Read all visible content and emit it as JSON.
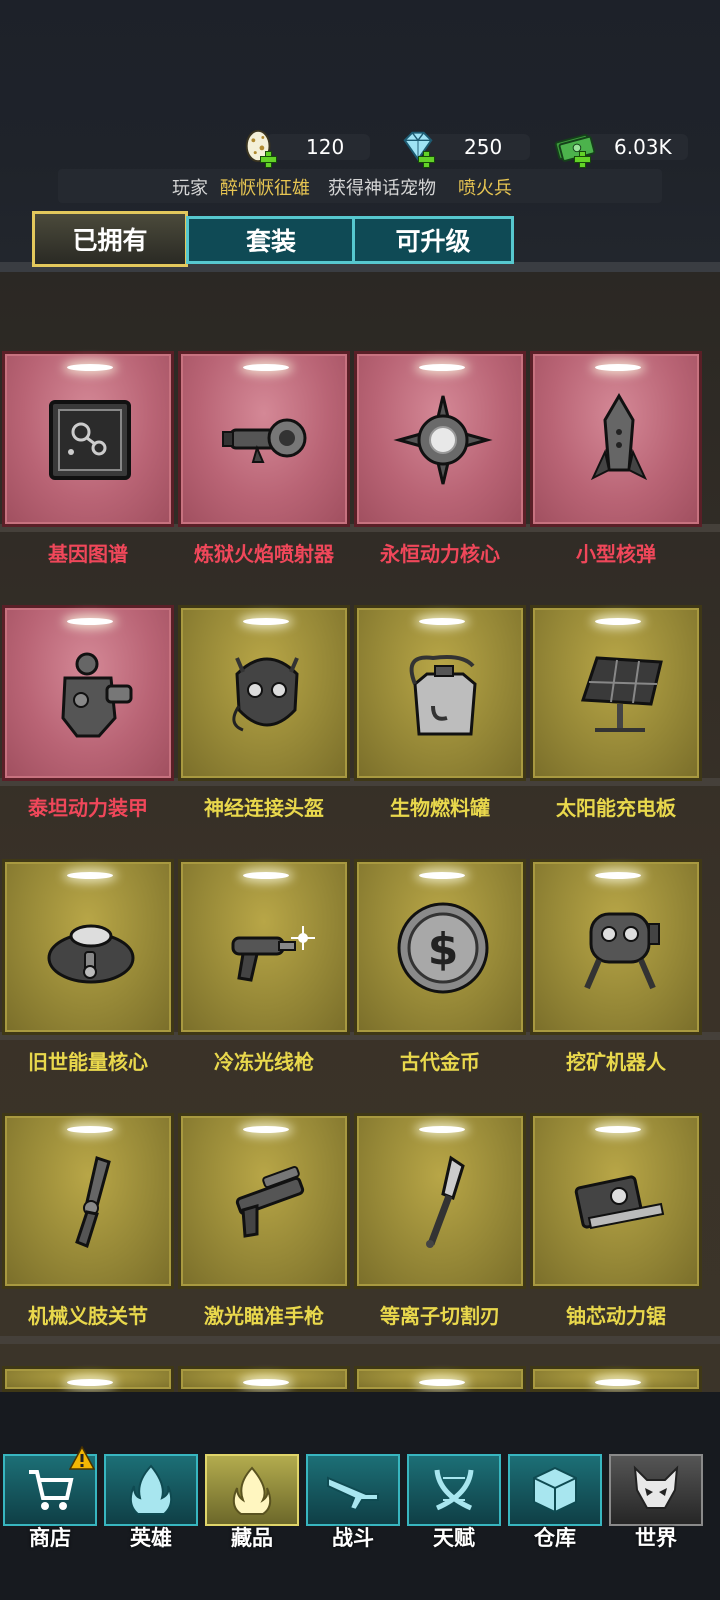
{
  "resources": {
    "eggs": {
      "value": "120",
      "icon": "egg-icon"
    },
    "gems": {
      "value": "250",
      "icon": "diamond-icon"
    },
    "cash": {
      "value": "6.03K",
      "icon": "cash-icon"
    }
  },
  "ticker": {
    "prefix": "玩家",
    "player": "醉恹恹征雄",
    "middle": "获得神话宠物",
    "pet": "喷火兵"
  },
  "tabs": [
    {
      "label": "已拥有",
      "active": true
    },
    {
      "label": "套装",
      "active": false
    },
    {
      "label": "可升级",
      "active": false
    }
  ],
  "items": [
    {
      "name": "基因图谱",
      "rarity": "red",
      "icon": "gene-map-icon"
    },
    {
      "name": "炼狱火焰喷射器",
      "rarity": "red",
      "icon": "flamethrower-icon"
    },
    {
      "name": "永恒动力核心",
      "rarity": "red",
      "icon": "power-core-icon"
    },
    {
      "name": "小型核弹",
      "rarity": "red",
      "icon": "nuke-icon"
    },
    {
      "name": "泰坦动力装甲",
      "rarity": "red",
      "icon": "power-armor-icon"
    },
    {
      "name": "神经连接头盔",
      "rarity": "gold",
      "icon": "neural-helmet-icon"
    },
    {
      "name": "生物燃料罐",
      "rarity": "gold",
      "icon": "fuel-tank-icon"
    },
    {
      "name": "太阳能充电板",
      "rarity": "gold",
      "icon": "solar-panel-icon"
    },
    {
      "name": "旧世能量核心",
      "rarity": "gold",
      "icon": "energy-core-icon"
    },
    {
      "name": "冷冻光线枪",
      "rarity": "gold",
      "icon": "freeze-ray-icon"
    },
    {
      "name": "古代金币",
      "rarity": "gold",
      "icon": "coin-icon"
    },
    {
      "name": "挖矿机器人",
      "rarity": "gold",
      "icon": "mining-robot-icon"
    },
    {
      "name": "机械义肢关节",
      "rarity": "gold",
      "icon": "prosthetic-icon"
    },
    {
      "name": "激光瞄准手枪",
      "rarity": "gold",
      "icon": "laser-pistol-icon"
    },
    {
      "name": "等离子切割刃",
      "rarity": "gold",
      "icon": "plasma-blade-icon"
    },
    {
      "name": "铀芯动力锯",
      "rarity": "gold",
      "icon": "power-saw-icon"
    }
  ],
  "nav": [
    {
      "label": "商店",
      "icon": "cart-icon",
      "state": "normal",
      "alert": true
    },
    {
      "label": "英雄",
      "icon": "hero-flame-icon",
      "state": "normal"
    },
    {
      "label": "藏品",
      "icon": "collection-flame-icon",
      "state": "active"
    },
    {
      "label": "战斗",
      "icon": "rifle-icon",
      "state": "normal"
    },
    {
      "label": "天赋",
      "icon": "dna-icon",
      "state": "normal"
    },
    {
      "label": "仓库",
      "icon": "crate-icon",
      "state": "normal"
    },
    {
      "label": "世界",
      "icon": "wolf-skull-icon",
      "state": "dark"
    }
  ],
  "colors": {
    "red_label": "#f0475a",
    "gold_label": "#e9d84c",
    "tab_active_border": "#e3c85c",
    "tab_inactive_border": "#57c8cf"
  }
}
